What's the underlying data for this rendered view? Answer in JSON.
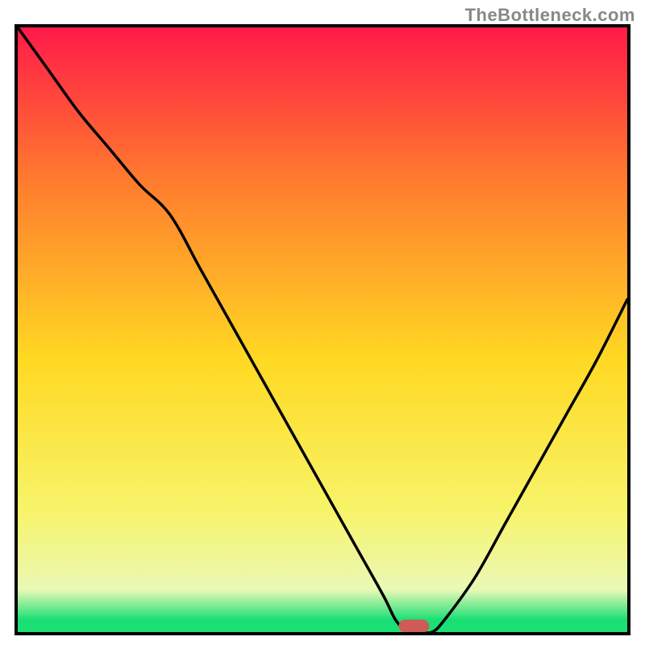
{
  "watermark": "TheBottleneck.com",
  "chart_data": {
    "type": "line",
    "title": "",
    "xlabel": "",
    "ylabel": "",
    "xlim": [
      0,
      100
    ],
    "ylim": [
      0,
      100
    ],
    "x": [
      0,
      5,
      10,
      15,
      20,
      25,
      30,
      35,
      40,
      45,
      50,
      55,
      60,
      62,
      64,
      66,
      68,
      70,
      75,
      80,
      85,
      90,
      95,
      100
    ],
    "values": [
      100,
      93,
      86,
      80,
      74,
      69,
      60,
      51,
      42,
      33,
      24,
      15,
      6,
      2,
      0,
      0,
      0,
      2,
      9,
      18,
      27,
      36,
      45,
      55
    ],
    "marker": {
      "x": 65,
      "y": 1
    },
    "gradient_colors": {
      "top": "#ff1a49",
      "mid_upper": "#ff7a2e",
      "mid": "#ffd922",
      "mid_lower": "#f7f46a",
      "bottom_band": "#eaf8b6",
      "bottom": "#1adf75"
    },
    "border_color": "#000000",
    "marker_color": "#cf5b56"
  }
}
